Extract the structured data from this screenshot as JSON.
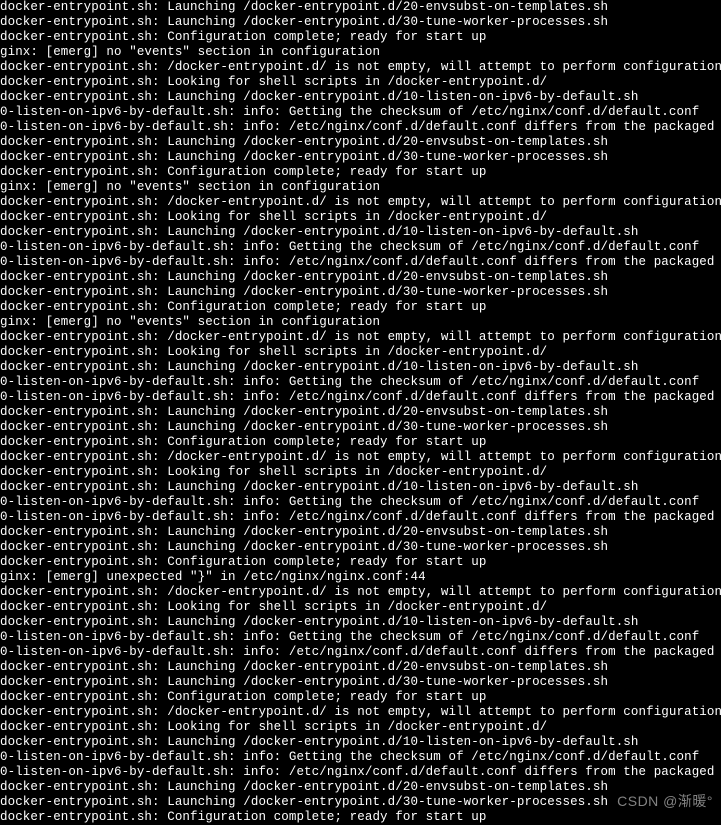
{
  "terminal": {
    "lines": [
      "docker-entrypoint.sh: Launching /docker-entrypoint.d/20-envsubst-on-templates.sh",
      "docker-entrypoint.sh: Launching /docker-entrypoint.d/30-tune-worker-processes.sh",
      "docker-entrypoint.sh: Configuration complete; ready for start up",
      "ginx: [emerg] no \"events\" section in configuration",
      "docker-entrypoint.sh: /docker-entrypoint.d/ is not empty, will attempt to perform configuration",
      "docker-entrypoint.sh: Looking for shell scripts in /docker-entrypoint.d/",
      "docker-entrypoint.sh: Launching /docker-entrypoint.d/10-listen-on-ipv6-by-default.sh",
      "0-listen-on-ipv6-by-default.sh: info: Getting the checksum of /etc/nginx/conf.d/default.conf",
      "0-listen-on-ipv6-by-default.sh: info: /etc/nginx/conf.d/default.conf differs from the packaged version",
      "docker-entrypoint.sh: Launching /docker-entrypoint.d/20-envsubst-on-templates.sh",
      "docker-entrypoint.sh: Launching /docker-entrypoint.d/30-tune-worker-processes.sh",
      "docker-entrypoint.sh: Configuration complete; ready for start up",
      "ginx: [emerg] no \"events\" section in configuration",
      "docker-entrypoint.sh: /docker-entrypoint.d/ is not empty, will attempt to perform configuration",
      "docker-entrypoint.sh: Looking for shell scripts in /docker-entrypoint.d/",
      "docker-entrypoint.sh: Launching /docker-entrypoint.d/10-listen-on-ipv6-by-default.sh",
      "0-listen-on-ipv6-by-default.sh: info: Getting the checksum of /etc/nginx/conf.d/default.conf",
      "0-listen-on-ipv6-by-default.sh: info: /etc/nginx/conf.d/default.conf differs from the packaged version",
      "docker-entrypoint.sh: Launching /docker-entrypoint.d/20-envsubst-on-templates.sh",
      "docker-entrypoint.sh: Launching /docker-entrypoint.d/30-tune-worker-processes.sh",
      "docker-entrypoint.sh: Configuration complete; ready for start up",
      "ginx: [emerg] no \"events\" section in configuration",
      "docker-entrypoint.sh: /docker-entrypoint.d/ is not empty, will attempt to perform configuration",
      "docker-entrypoint.sh: Looking for shell scripts in /docker-entrypoint.d/",
      "docker-entrypoint.sh: Launching /docker-entrypoint.d/10-listen-on-ipv6-by-default.sh",
      "0-listen-on-ipv6-by-default.sh: info: Getting the checksum of /etc/nginx/conf.d/default.conf",
      "0-listen-on-ipv6-by-default.sh: info: /etc/nginx/conf.d/default.conf differs from the packaged version",
      "docker-entrypoint.sh: Launching /docker-entrypoint.d/20-envsubst-on-templates.sh",
      "docker-entrypoint.sh: Launching /docker-entrypoint.d/30-tune-worker-processes.sh",
      "docker-entrypoint.sh: Configuration complete; ready for start up",
      "docker-entrypoint.sh: /docker-entrypoint.d/ is not empty, will attempt to perform configuration",
      "docker-entrypoint.sh: Looking for shell scripts in /docker-entrypoint.d/",
      "docker-entrypoint.sh: Launching /docker-entrypoint.d/10-listen-on-ipv6-by-default.sh",
      "0-listen-on-ipv6-by-default.sh: info: Getting the checksum of /etc/nginx/conf.d/default.conf",
      "0-listen-on-ipv6-by-default.sh: info: /etc/nginx/conf.d/default.conf differs from the packaged version",
      "docker-entrypoint.sh: Launching /docker-entrypoint.d/20-envsubst-on-templates.sh",
      "docker-entrypoint.sh: Launching /docker-entrypoint.d/30-tune-worker-processes.sh",
      "docker-entrypoint.sh: Configuration complete; ready for start up",
      "ginx: [emerg] unexpected \"}\" in /etc/nginx/nginx.conf:44",
      "docker-entrypoint.sh: /docker-entrypoint.d/ is not empty, will attempt to perform configuration",
      "docker-entrypoint.sh: Looking for shell scripts in /docker-entrypoint.d/",
      "docker-entrypoint.sh: Launching /docker-entrypoint.d/10-listen-on-ipv6-by-default.sh",
      "0-listen-on-ipv6-by-default.sh: info: Getting the checksum of /etc/nginx/conf.d/default.conf",
      "0-listen-on-ipv6-by-default.sh: info: /etc/nginx/conf.d/default.conf differs from the packaged version",
      "docker-entrypoint.sh: Launching /docker-entrypoint.d/20-envsubst-on-templates.sh",
      "docker-entrypoint.sh: Launching /docker-entrypoint.d/30-tune-worker-processes.sh",
      "docker-entrypoint.sh: Configuration complete; ready for start up",
      "docker-entrypoint.sh: /docker-entrypoint.d/ is not empty, will attempt to perform configuration",
      "docker-entrypoint.sh: Looking for shell scripts in /docker-entrypoint.d/",
      "docker-entrypoint.sh: Launching /docker-entrypoint.d/10-listen-on-ipv6-by-default.sh",
      "0-listen-on-ipv6-by-default.sh: info: Getting the checksum of /etc/nginx/conf.d/default.conf",
      "0-listen-on-ipv6-by-default.sh: info: /etc/nginx/conf.d/default.conf differs from the packaged version",
      "docker-entrypoint.sh: Launching /docker-entrypoint.d/20-envsubst-on-templates.sh",
      "docker-entrypoint.sh: Launching /docker-entrypoint.d/30-tune-worker-processes.sh",
      "docker-entrypoint.sh: Configuration complete; ready for start up"
    ]
  },
  "watermark": {
    "text": "CSDN @渐暖°"
  }
}
